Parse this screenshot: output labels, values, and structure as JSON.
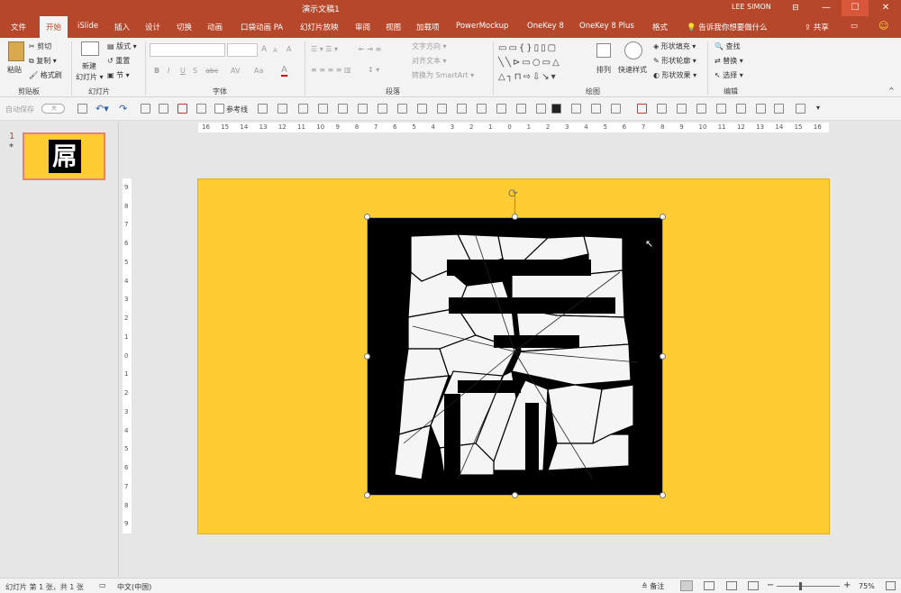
{
  "window": {
    "title": "演示文稿1",
    "user": "LEE SIMON",
    "controls": {
      "minimize": "—",
      "maximize": "☐",
      "close": "✕",
      "restore": "⊟"
    }
  },
  "tabs": [
    {
      "label": "文件"
    },
    {
      "label": "开始"
    },
    {
      "label": "iSlide"
    },
    {
      "label": "插入"
    },
    {
      "label": "设计"
    },
    {
      "label": "切换"
    },
    {
      "label": "动画"
    },
    {
      "label": "口袋动画 PA"
    },
    {
      "label": "幻灯片放映"
    },
    {
      "label": "审阅"
    },
    {
      "label": "视图"
    },
    {
      "label": "加载项"
    },
    {
      "label": "PowerMockup"
    },
    {
      "label": "OneKey 8"
    },
    {
      "label": "OneKey 8 Plus"
    },
    {
      "label": "格式"
    }
  ],
  "tell_me": "告诉我你想要做什么",
  "share": "共享",
  "ribbon": {
    "clipboard": {
      "paste": "粘贴",
      "cut": "剪切",
      "copy": "复制",
      "format_painter": "格式刷",
      "label": "剪贴板"
    },
    "slides": {
      "new_slide": "新建",
      "new_slide2": "幻灯片",
      "layout": "版式",
      "reset": "重置",
      "section": "节",
      "label": "幻灯片"
    },
    "font": {
      "label": "字体",
      "bold": "B",
      "italic": "I",
      "underline": "U",
      "strike": "S",
      "shadow": "abc",
      "spacing": "AV",
      "case": "Aa",
      "grow": "A",
      "shrink": "A",
      "clear": "A"
    },
    "paragraph": {
      "text_direction": "文字方向",
      "align_text": "对齐文本",
      "smartart": "转换为 SmartArt",
      "label": "段落"
    },
    "drawing": {
      "arrange": "排列",
      "quick_styles": "快速样式",
      "shape_fill": "形状填充",
      "shape_outline": "形状轮廓",
      "shape_effects": "形状效果",
      "label": "绘图"
    },
    "editing": {
      "find": "查找",
      "replace": "替换",
      "select": "选择",
      "label": "编辑"
    }
  },
  "qat": {
    "autosave": "自动保存",
    "autosave_state": "关",
    "guides": "参考线"
  },
  "ruler": {
    "h_ticks": [
      "16",
      "15",
      "14",
      "13",
      "12",
      "11",
      "10",
      "9",
      "8",
      "7",
      "6",
      "5",
      "4",
      "3",
      "2",
      "1",
      "0",
      "1",
      "2",
      "3",
      "4",
      "5",
      "6",
      "7",
      "8",
      "9",
      "10",
      "11",
      "12",
      "13",
      "14",
      "15",
      "16"
    ],
    "v_ticks": [
      "9",
      "8",
      "7",
      "6",
      "5",
      "4",
      "3",
      "2",
      "1",
      "0",
      "1",
      "2",
      "3",
      "4",
      "5",
      "6",
      "7",
      "8",
      "9"
    ]
  },
  "thumbnail": {
    "number": "1",
    "star": "*",
    "glyph": "屌"
  },
  "slide": {
    "glyph": "屌",
    "background": "#ffcd33",
    "image_bg": "#000000"
  },
  "status": {
    "slide_info": "幻灯片 第 1 张，共 1 张",
    "language": "中文(中国)",
    "notes": "备注",
    "zoom": "75%",
    "zoom_minus": "−",
    "zoom_plus": "+",
    "zoom_level": 0.75
  },
  "colors": {
    "accent": "#b7472a",
    "slide_bg": "#ffcd33"
  }
}
